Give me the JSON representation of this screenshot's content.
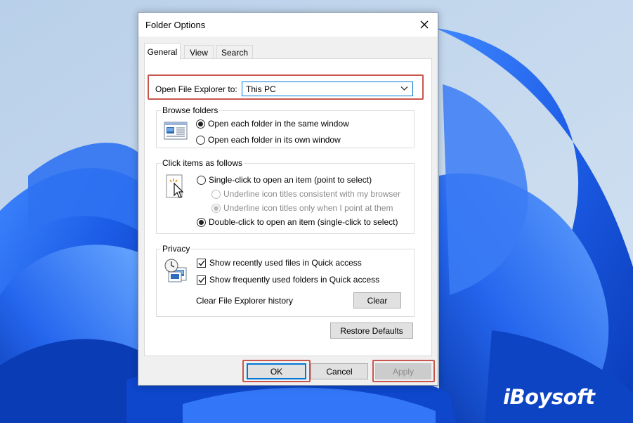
{
  "watermark": "iBoysoft",
  "dialog": {
    "title": "Folder Options",
    "tabs": [
      {
        "label": "General",
        "active": true
      },
      {
        "label": "View",
        "active": false
      },
      {
        "label": "Search",
        "active": false
      }
    ],
    "open_explorer": {
      "label": "Open File Explorer to:",
      "selected": "This PC"
    },
    "browse_folders": {
      "title": "Browse folders",
      "options": [
        {
          "label": "Open each folder in the same window",
          "checked": true
        },
        {
          "label": "Open each folder in its own window",
          "checked": false
        }
      ]
    },
    "click_items": {
      "title": "Click items as follows",
      "single_click": "Single-click to open an item (point to select)",
      "underline_browser": "Underline icon titles consistent with my browser",
      "underline_point": "Underline icon titles only when I point at them",
      "double_click": "Double-click to open an item (single-click to select)"
    },
    "privacy": {
      "title": "Privacy",
      "recent_files": "Show recently used files in Quick access",
      "frequent_folders": "Show frequently used folders in Quick access",
      "clear_history_label": "Clear File Explorer history",
      "clear_button": "Clear"
    },
    "restore_defaults": "Restore Defaults",
    "buttons": {
      "ok": "OK",
      "cancel": "Cancel",
      "apply": "Apply"
    }
  },
  "colors": {
    "highlight": "#c8564e",
    "accent": "#0078d7",
    "wallpaper_bg": "#bcd3ea",
    "bloom": "#1f5fe0"
  },
  "icons": {
    "close": "close-icon",
    "dropdown": "chevron-down-icon",
    "browse": "folder-window-icon",
    "click": "pointer-click-icon",
    "privacy": "clock-history-icon"
  }
}
